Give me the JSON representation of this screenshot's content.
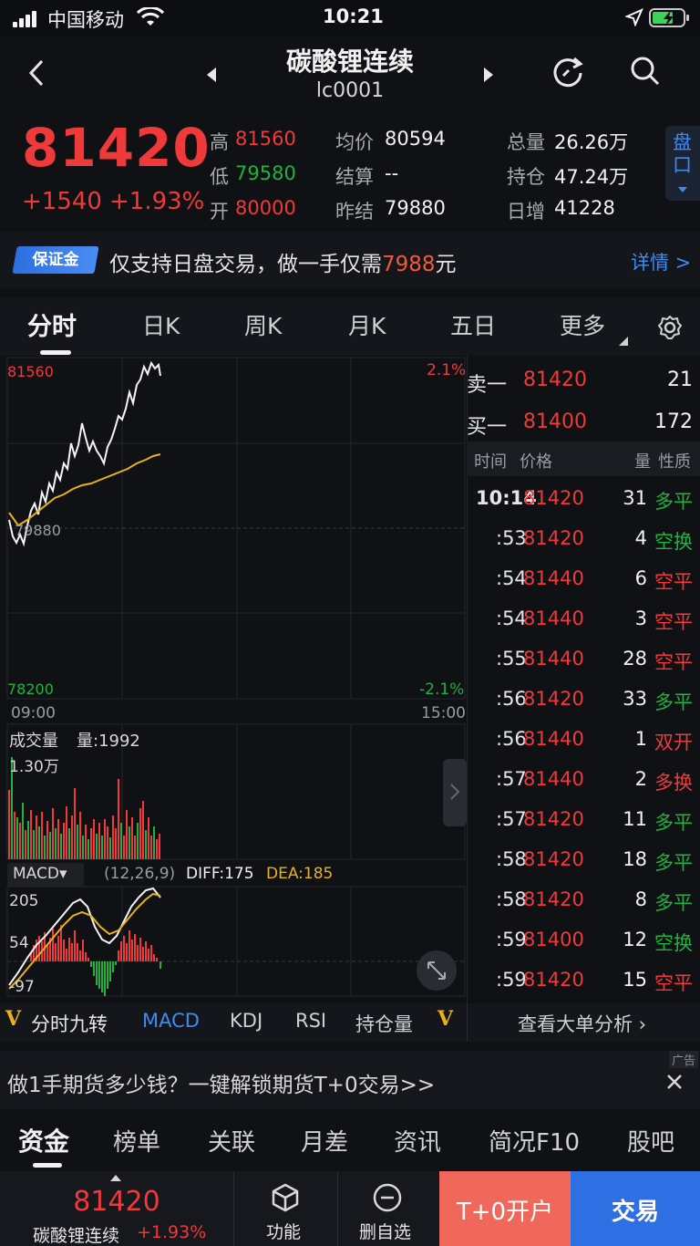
{
  "status": {
    "carrier": "中国移动",
    "time": "10:21"
  },
  "header": {
    "title": "碳酸锂连续",
    "code": "lc0001"
  },
  "quote": {
    "price": "81420",
    "change": "+1540",
    "change_pct": "+1.93%",
    "high_label": "高",
    "high": "81560",
    "low_label": "低",
    "low": "79580",
    "open_label": "开",
    "open": "80000",
    "avg_label": "均价",
    "avg": "80594",
    "settle_label": "结算",
    "settle": "--",
    "prev_settle_label": "昨结",
    "prev_settle": "79880",
    "volume_label": "总量",
    "volume": "26.26万",
    "oi_label": "持仓",
    "oi": "47.24万",
    "daily_inc_label": "日增",
    "daily_inc": "41228",
    "panel_label": "盘口"
  },
  "banner": {
    "badge": "保证金",
    "text_pre": "仅支持日盘交易，做一手仅需",
    "amount": "7988",
    "text_post": "元",
    "link": "详情 >"
  },
  "tabs": [
    "分时",
    "日K",
    "周K",
    "月K",
    "五日",
    "更多"
  ],
  "chart": {
    "price_top": "81560",
    "pct_top": "2.1%",
    "price_mid": "79880",
    "price_bottom": "78200",
    "pct_bottom": "-2.1%",
    "time_start": "09:00",
    "time_end": "15:00",
    "volume_title": "成交量",
    "volume_value": "量:1992",
    "volume_max": "1.30万",
    "macd_label": "MACD▾",
    "macd_params": "(12,26,9)",
    "diff": "DIFF:175",
    "dea": "DEA:185",
    "macd_top": "205",
    "macd_mid": "54",
    "macd_bottom": "-97"
  },
  "orderbook": {
    "ask_label": "卖一",
    "ask_price": "81420",
    "ask_vol": "21",
    "bid_label": "买一",
    "bid_price": "81400",
    "bid_vol": "172",
    "col_time": "时间",
    "col_price": "价格",
    "col_qty": "量",
    "col_type": "性质",
    "rows": [
      {
        "time": "10:14",
        "price": "81420",
        "qty": "31",
        "type": "多平",
        "color": "#1fb33e"
      },
      {
        "time": ":53",
        "price": "81420",
        "qty": "4",
        "type": "空换",
        "color": "#1fb33e"
      },
      {
        "time": ":54",
        "price": "81440",
        "qty": "6",
        "type": "空平",
        "color": "#ee3a3a"
      },
      {
        "time": ":54",
        "price": "81440",
        "qty": "3",
        "type": "空平",
        "color": "#ee3a3a"
      },
      {
        "time": ":55",
        "price": "81440",
        "qty": "28",
        "type": "空平",
        "color": "#ee3a3a"
      },
      {
        "time": ":56",
        "price": "81420",
        "qty": "33",
        "type": "多平",
        "color": "#1fb33e"
      },
      {
        "time": ":56",
        "price": "81440",
        "qty": "1",
        "type": "双开",
        "color": "#ee3a3a"
      },
      {
        "time": ":57",
        "price": "81440",
        "qty": "2",
        "type": "多换",
        "color": "#ee3a3a"
      },
      {
        "time": ":57",
        "price": "81420",
        "qty": "11",
        "type": "多平",
        "color": "#1fb33e"
      },
      {
        "time": ":58",
        "price": "81420",
        "qty": "18",
        "type": "多平",
        "color": "#1fb33e"
      },
      {
        "time": ":58",
        "price": "81420",
        "qty": "8",
        "type": "多平",
        "color": "#1fb33e"
      },
      {
        "time": ":59",
        "price": "81400",
        "qty": "12",
        "type": "空换",
        "color": "#1fb33e"
      },
      {
        "time": ":59",
        "price": "81420",
        "qty": "15",
        "type": "空平",
        "color": "#ee3a3a"
      }
    ]
  },
  "indicators": {
    "nine": "分时九转",
    "macd": "MACD",
    "kdj": "KDJ",
    "rsi": "RSI",
    "oi": "持仓量",
    "big_order": "查看大单分析 ›"
  },
  "ad": {
    "text": "做1手期货多少钱？一键解锁期货T+0交易>>",
    "tag": "广告"
  },
  "bottom_tabs": [
    "资金",
    "榜单",
    "关联",
    "月差",
    "资讯",
    "简况F10",
    "股吧"
  ],
  "bottom_bar": {
    "price": "81420",
    "name": "碳酸锂连续",
    "pct": "+1.93%",
    "func": "功能",
    "remove": "删自选",
    "open_account": "T+0开户",
    "trade": "交易"
  },
  "colors": {
    "up": "#ee3a3a",
    "down": "#1fb33e",
    "accent": "#3d8bf2",
    "open_account_bg": "#f0675b",
    "trade_bg": "#2f6fe4"
  }
}
